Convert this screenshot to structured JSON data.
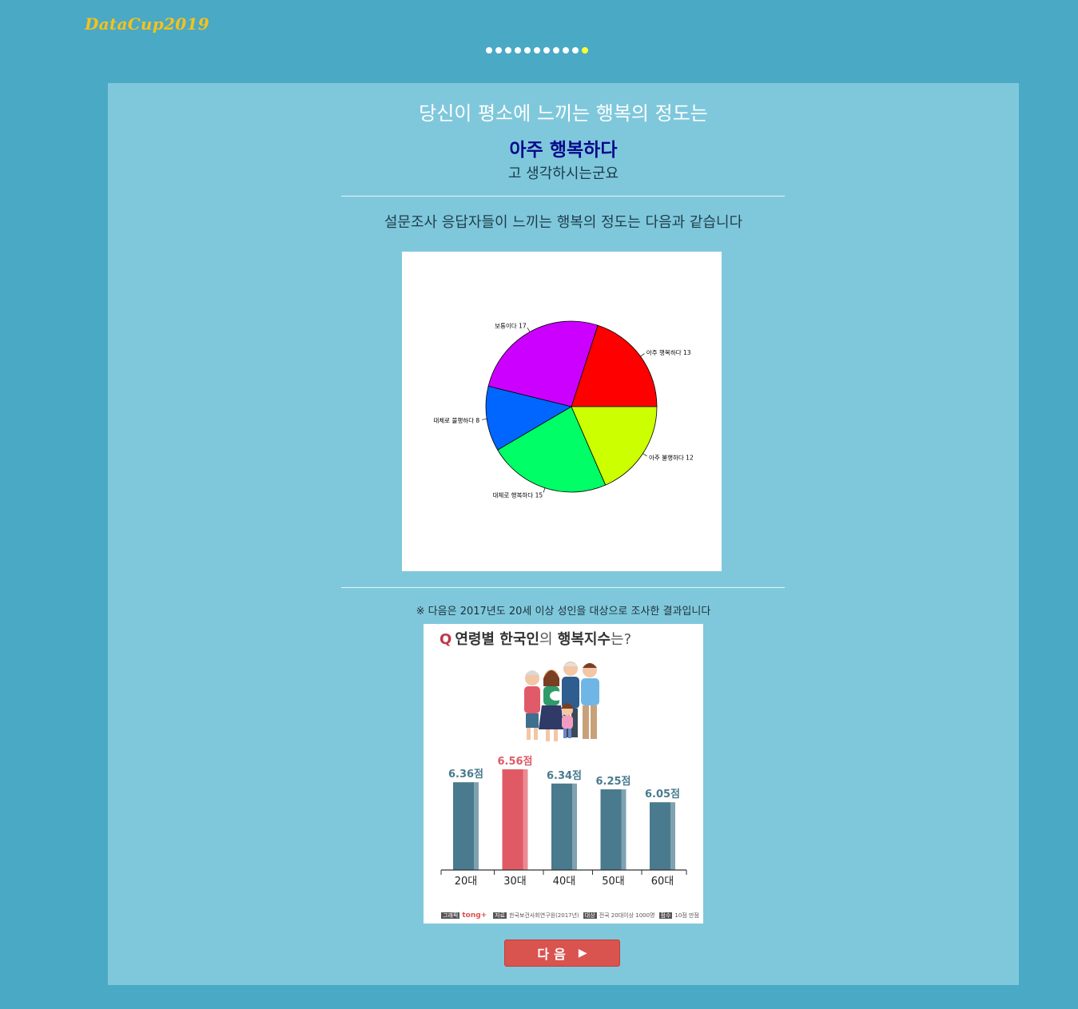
{
  "brand": "DataCup2019",
  "progress": {
    "total": 11,
    "current": 11
  },
  "question": "당신이 평소에 느끼는 행복의 정도는",
  "answer": "아주 행복하다",
  "answer_suffix": "고 생각하시는군요",
  "survey_title": "설문조사 응답자들이 느끼는 행복의 정도는 다음과 같습니다",
  "chart_data": [
    {
      "type": "pie",
      "slices": [
        {
          "label": "아주 행복하다",
          "value": 13,
          "color": "#ff0000"
        },
        {
          "label": "보통이다",
          "value": 17,
          "color": "#cc00ff"
        },
        {
          "label": "대체로 불행하다",
          "value": 8,
          "color": "#0066ff"
        },
        {
          "label": "대체로 행복하다",
          "value": 15,
          "color": "#00ff66"
        },
        {
          "label": "아주 불행하다",
          "value": 12,
          "color": "#ccff00"
        }
      ]
    },
    {
      "type": "bar",
      "title": "Q 연령별 한국인의 행복지수는?",
      "categories": [
        "20대",
        "30대",
        "40대",
        "50대",
        "60대"
      ],
      "values": [
        6.36,
        6.56,
        6.34,
        6.25,
        6.05
      ],
      "value_labels": [
        "6.36점",
        "6.56점",
        "6.34점",
        "6.25점",
        "6.05점"
      ],
      "highlight_index": 1,
      "colors": {
        "normal": "#4a7a8e",
        "highlight": "#e05a65"
      }
    }
  ],
  "note": "※ 다음은 2017년도 20세 이상 성인을 대상으로 조사한 결과입니다",
  "infographic": {
    "title_q": "Q",
    "title_a": "연령별 한국인",
    "title_b": "의",
    "title_c": "행복지수",
    "title_d": "는?",
    "footer": {
      "graphic_tag": "그래픽",
      "brand": "tong+",
      "source_tag": "자료",
      "source": "한국보건사회연구원(2017년)",
      "target_tag": "대상",
      "target": "전국 20대이상 1000명",
      "score_tag": "점수",
      "score": "10점 만점"
    }
  },
  "next_button": {
    "label": "다음",
    "icon": "play-triangle-icon"
  }
}
